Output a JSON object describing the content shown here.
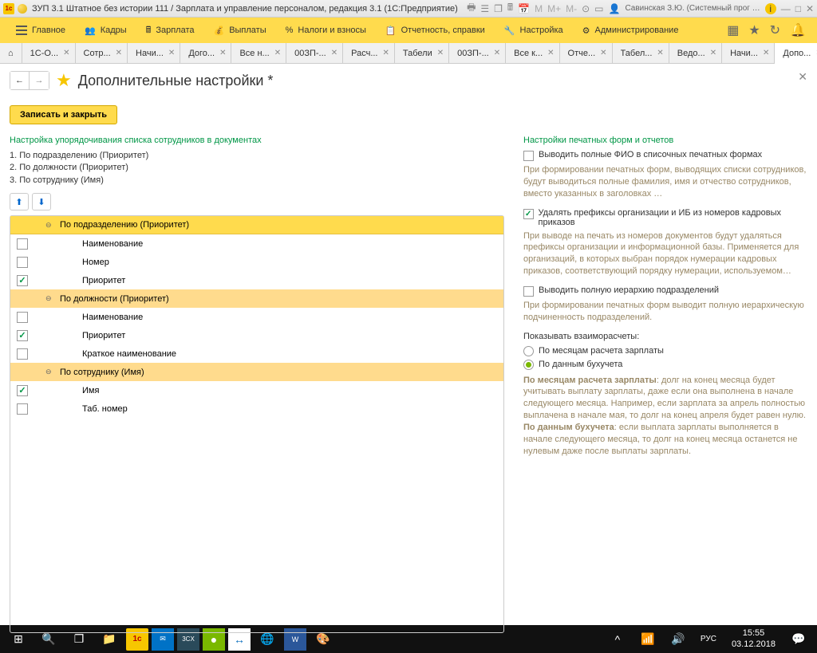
{
  "window": {
    "title": "ЗУП 3.1 Штатное без истории 111 / Зарплата и управление персоналом, редакция 3.1  (1С:Предприятие)",
    "user": "Савинская З.Ю. (Системный прог …"
  },
  "menu": {
    "items": [
      "Главное",
      "Кадры",
      "Зарплата",
      "Выплаты",
      "Налоги и взносы",
      "Отчетность, справки",
      "Настройка",
      "Администрирование"
    ]
  },
  "tabs": {
    "items": [
      "1С-О...",
      "Сотр...",
      "Начи...",
      "Дого...",
      "Все н...",
      "00ЗП-...",
      "Расч...",
      "Табели",
      "00ЗП-...",
      "Все к...",
      "Отче...",
      "Табел...",
      "Ведо...",
      "Начи...",
      "Допо..."
    ],
    "activeIndex": 14
  },
  "page": {
    "title": "Дополнительные настройки *",
    "save": "Записать и закрыть"
  },
  "leftPanel": {
    "sectionTitle": "Настройка упорядочивания списка сотрудников в документах",
    "orderList": [
      "1. По подразделению (Приоритет)",
      "2. По должности (Приоритет)",
      "3. По сотруднику (Имя)"
    ],
    "tree": [
      {
        "type": "group",
        "label": "По подразделению (Приоритет)",
        "first": true
      },
      {
        "type": "item",
        "label": "Наименование",
        "checked": false
      },
      {
        "type": "item",
        "label": "Номер",
        "checked": false
      },
      {
        "type": "item",
        "label": "Приоритет",
        "checked": true
      },
      {
        "type": "group",
        "label": "По должности (Приоритет)"
      },
      {
        "type": "item",
        "label": "Наименование",
        "checked": false
      },
      {
        "type": "item",
        "label": "Приоритет",
        "checked": true
      },
      {
        "type": "item",
        "label": "Краткое наименование",
        "checked": false
      },
      {
        "type": "group",
        "label": "По сотруднику (Имя)"
      },
      {
        "type": "item",
        "label": "Имя",
        "checked": true
      },
      {
        "type": "item",
        "label": "Таб. номер",
        "checked": false
      }
    ]
  },
  "rightPanel": {
    "sectionTitle": "Настройки печатных форм и отчетов",
    "check1": {
      "label": "Выводить полные ФИО в списочных печатных формах",
      "checked": false
    },
    "help1": "При формировании печатных форм, выводящих списки сотрудников, будут выводиться полные фамилия, имя и отчество сотрудников, вместо указанных в заголовках …",
    "check2": {
      "label": "Удалять префиксы организации и ИБ из номеров кадровых приказов",
      "checked": true
    },
    "help2": "При выводе на печать из номеров документов будут удаляться префиксы организации и информационной базы. Применяется для организаций, в которых выбран порядок нумерации кадровых приказов, соответствующий порядку нумерации, используемом…",
    "check3": {
      "label": "Выводить полную иерархию подразделений",
      "checked": false
    },
    "help3": "При формировании печатных форм выводит полную иерархическую подчиненность подразделений.",
    "radioLabel": "Показывать взаиморасчеты:",
    "radio1": "По месяцам расчета зарплаты",
    "radio2": "По данным бухучета",
    "radioSelected": 1,
    "help4a_bold": "По месяцам расчета зарплаты",
    "help4a": ": долг на конец месяца будет учитывать выплату зарплаты, даже если она выполнена в начале следующего месяца. Например, если зарплата за апрель полностью выплачена в начале мая, то долг на конец апреля будет равен нулю.",
    "help4b_bold": "По данным бухучета",
    "help4b": ": если выплата зарплаты выполняется в начале следующего месяца, то долг на конец месяца останется не нулевым даже после выплаты зарплаты."
  },
  "taskbar": {
    "time": "15:55",
    "date": "03.12.2018",
    "lang": "РУС"
  }
}
